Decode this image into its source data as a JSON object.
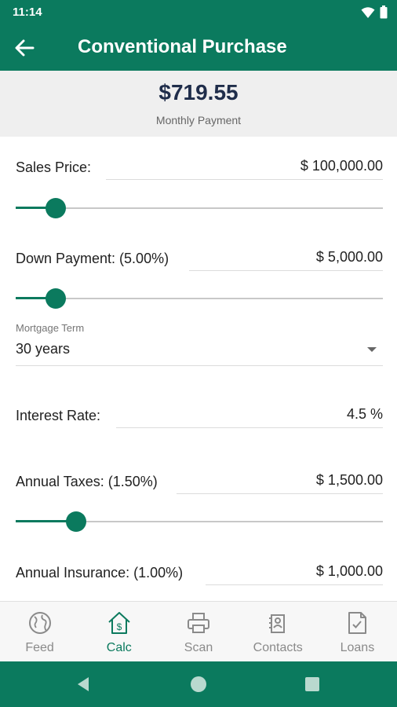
{
  "status_bar": {
    "time": "11:14"
  },
  "app_bar": {
    "title": "Conventional Purchase"
  },
  "summary": {
    "amount": "$719.55",
    "label": "Monthly Payment"
  },
  "fields": {
    "sales_price": {
      "label": "Sales Price:",
      "value": "$ 100,000.00",
      "slider_fraction": 0.11
    },
    "down_payment": {
      "label": "Down Payment: (5.00%)",
      "value": "$ 5,000.00",
      "slider_fraction": 0.11
    },
    "mortgage_term": {
      "caption": "Mortgage Term",
      "value": "30 years"
    },
    "interest_rate": {
      "label": "Interest Rate:",
      "value": "4.5 %"
    },
    "annual_taxes": {
      "label": "Annual Taxes: (1.50%)",
      "value": "$ 1,500.00",
      "slider_fraction": 0.165
    },
    "annual_insurance": {
      "label": "Annual Insurance: (1.00%)",
      "value": "$ 1,000.00"
    }
  },
  "bottom_nav": {
    "items": [
      {
        "label": "Feed",
        "icon": "globe-icon",
        "active": false
      },
      {
        "label": "Calc",
        "icon": "calc-home-icon",
        "active": true
      },
      {
        "label": "Scan",
        "icon": "printer-icon",
        "active": false
      },
      {
        "label": "Contacts",
        "icon": "contacts-icon",
        "active": false
      },
      {
        "label": "Loans",
        "icon": "document-icon",
        "active": false
      }
    ]
  },
  "colors": {
    "primary": "#0b7a5e",
    "summary_bg": "#efefef",
    "amount": "#1f2d4a"
  }
}
